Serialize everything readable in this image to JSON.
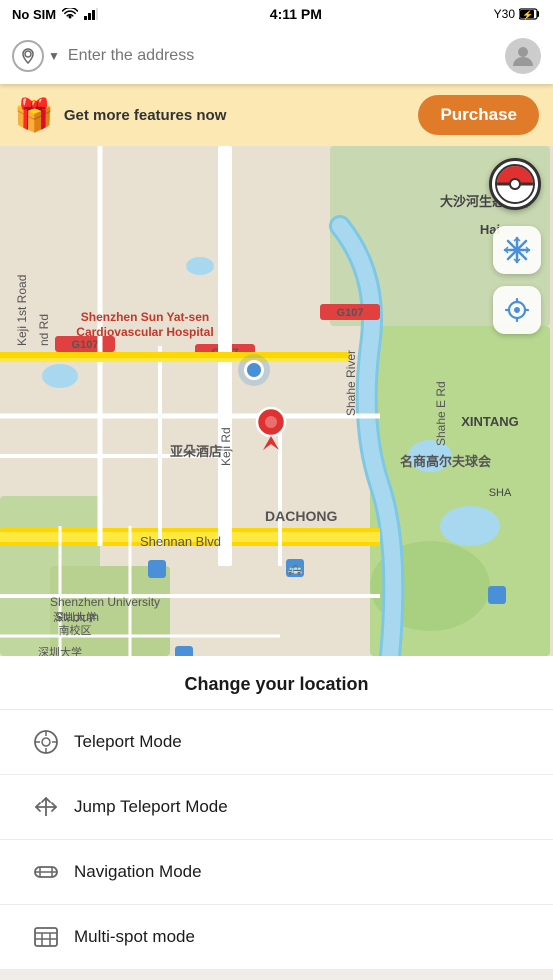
{
  "statusBar": {
    "carrier": "No SIM",
    "time": "4:11 PM",
    "battery_label": "Y30",
    "wifi": "wifi",
    "signal": "signal"
  },
  "searchBar": {
    "placeholder": "Enter the address",
    "location_icon": "location-pin-icon",
    "chevron_icon": "chevron-down-icon",
    "avatar_icon": "user-avatar-icon"
  },
  "banner": {
    "gift_icon": "🎁",
    "text": "Get more features now",
    "purchase_label": "Purchase"
  },
  "map": {
    "pokeball_icon": "pokeball-icon",
    "snowflake_icon": "❄",
    "locate_icon": "locate-icon"
  },
  "bottomPanel": {
    "title": "Change your location",
    "modes": [
      {
        "id": "teleport",
        "label": "Teleport Mode",
        "icon": "teleport-icon"
      },
      {
        "id": "jump-teleport",
        "label": "Jump Teleport Mode",
        "icon": "jump-teleport-icon"
      },
      {
        "id": "navigation",
        "label": "Navigation Mode",
        "icon": "navigation-mode-icon"
      },
      {
        "id": "multi-spot",
        "label": "Multi-spot mode",
        "icon": "multi-spot-icon"
      }
    ]
  }
}
